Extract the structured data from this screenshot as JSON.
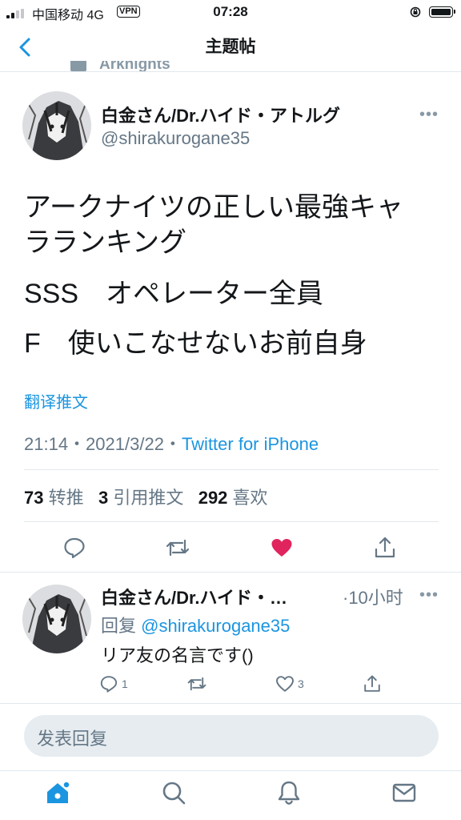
{
  "status_bar": {
    "carrier": "中国移动",
    "network": "4G",
    "vpn": "VPN",
    "time": "07:28"
  },
  "nav": {
    "title": "主题帖"
  },
  "context_label": "Arknights",
  "tweet": {
    "author_name": "白金さん/Dr.ハイド・アトルグ",
    "author_handle": "@shirakurogane35",
    "text_lines": [
      "アークナイツの正しい最強キャ",
      "ラランキング",
      "SSS　オペレーター全員",
      "F　使いこなせないお前自身"
    ],
    "translate": "翻译推文",
    "timestamp": "21:14・2021/3/22・",
    "source": "Twitter for iPhone",
    "stats": {
      "retweets_count": "73",
      "retweets_label": "转推",
      "quotes_count": "3",
      "quotes_label": "引用推文",
      "likes_count": "292",
      "likes_label": "喜欢"
    },
    "liked": true
  },
  "reply": {
    "author_name": "白金さん/Dr.ハイド・…",
    "time": "·10小时",
    "replying_to_label": "回复",
    "replying_to_handle": "@shirakurogane35",
    "text": "リア友の名言です()",
    "reply_count": "1",
    "retweet_count": "",
    "like_count": "3"
  },
  "compose": {
    "placeholder": "发表回复"
  },
  "colors": {
    "accent": "#1b95e0",
    "like": "#e0245e",
    "muted": "#657786",
    "divider": "#e1e8ed"
  },
  "icons": [
    "back-chevron-icon",
    "more-icon",
    "reply-icon",
    "retweet-icon",
    "heart-icon",
    "share-icon",
    "home-icon",
    "search-icon",
    "notifications-icon",
    "messages-icon"
  ]
}
